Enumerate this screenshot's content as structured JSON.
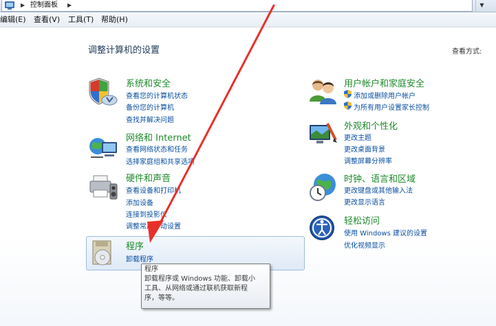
{
  "address": {
    "crumb": "控制面板",
    "separator": "▶",
    "dropdown": "▼"
  },
  "menu": [
    {
      "label": "编辑(E)"
    },
    {
      "label": "查看(V)"
    },
    {
      "label": "工具(T)"
    },
    {
      "label": "帮助(H)"
    }
  ],
  "main": {
    "title": "调整计算机的设置",
    "view_by": "查看方式:"
  },
  "categories": {
    "system": {
      "title": "系统和安全",
      "links": [
        "查看您的计算机状态",
        "备份您的计算机",
        "查找并解决问题"
      ],
      "icon": "shield-icon"
    },
    "network": {
      "title": "网络和 Internet",
      "links": [
        "查看网络状态和任务",
        "选择家庭组和共享选项"
      ],
      "icon": "network-globe-icon"
    },
    "hardware": {
      "title": "硬件和声音",
      "links": [
        "查看设备和打印机",
        "添加设备",
        "连接到投影仪",
        "调整常用移动设置"
      ],
      "icon": "printer-icon"
    },
    "programs": {
      "title": "程序",
      "links": [
        "卸载程序"
      ],
      "icon": "programs-disc-icon"
    },
    "users": {
      "title": "用户帐户和家庭安全",
      "links": [
        "添加或删除用户帐户",
        "为所有用户设置家长控制"
      ],
      "icon": "users-icon"
    },
    "appearance": {
      "title": "外观和个性化",
      "links": [
        "更改主题",
        "更改桌面背景",
        "调整屏幕分辨率"
      ],
      "icon": "display-paint-icon"
    },
    "clock": {
      "title": "时钟、语言和区域",
      "links": [
        "更改键盘或其他输入法",
        "更改显示语言"
      ],
      "icon": "clock-globe-icon"
    },
    "ease": {
      "title": "轻松访问",
      "links": [
        "使用 Windows 建议的设置",
        "优化视频显示"
      ],
      "icon": "ease-of-access-icon"
    }
  },
  "tooltip": {
    "lines": [
      "程序",
      "卸载程序或 Windows 功能、卸载小",
      "工具、从网络或通过联机获取新程",
      "序，等等。"
    ]
  },
  "colors": {
    "category_title": "#1d8a2a",
    "link": "#0b4fa1",
    "page_title": "#1e395b",
    "annotation_arrow": "#e8302a"
  }
}
